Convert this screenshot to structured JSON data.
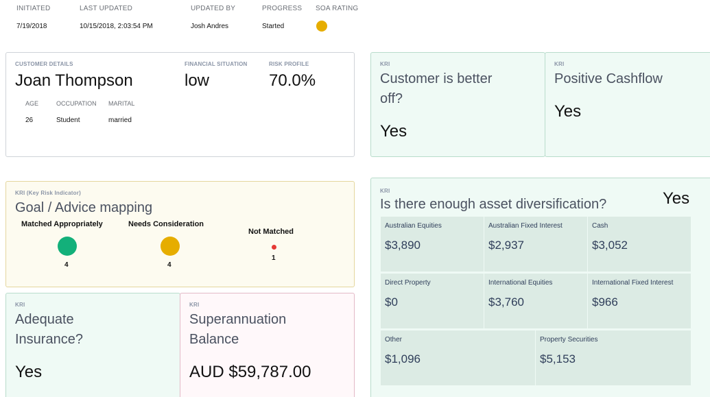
{
  "meta": {
    "labels": {
      "initiated": "INITIATED",
      "last_updated": "LAST UPDATED",
      "updated_by": "UPDATED BY",
      "progress": "PROGRESS",
      "soa_rating": "SOA RATING"
    },
    "values": {
      "initiated": "7/19/2018",
      "last_updated": "10/15/2018, 2:03:54 PM",
      "updated_by": "Josh Andres",
      "progress": "Started"
    },
    "soa_color": "#e6ad00"
  },
  "customer": {
    "section_label": "CUSTOMER DETAILS",
    "name": "Joan Thompson",
    "financial_label": "FINANCIAL SITUATION",
    "financial_value": "low",
    "risk_label": "RISK PROFILE",
    "risk_value": "70.0%",
    "age_label": "AGE",
    "age_value": "26",
    "occupation_label": "OCCUPATION",
    "occupation_value": "Student",
    "marital_label": "MARITAL",
    "marital_value": "married"
  },
  "kri_better_off": {
    "tag": "KRI",
    "title_line1": "Customer is better",
    "title_line2": "off?",
    "answer": "Yes"
  },
  "kri_cashflow": {
    "tag": "KRI",
    "title": "Positive Cashflow",
    "answer": "Yes"
  },
  "goal": {
    "tag": "KRI (Key Risk Indicator)",
    "title": "Goal / Advice mapping",
    "matched_label": "Matched Appropriately",
    "matched_count": "4",
    "matched_color": "#13b07a",
    "needs_label": "Needs Consideration",
    "needs_count": "4",
    "needs_color": "#e6ad00",
    "not_label": "Not Matched",
    "not_count": "1",
    "not_color": "#e53935"
  },
  "kri_insurance": {
    "tag": "KRI",
    "title_line1": "Adequate",
    "title_line2": "Insurance?",
    "answer": "Yes"
  },
  "kri_super": {
    "tag": "KRI",
    "title_line1": "Superannuation",
    "title_line2": "Balance",
    "answer": "AUD $59,787.00"
  },
  "kri_diversification": {
    "tag": "KRI",
    "title": "Is there enough asset diversification?",
    "answer": "Yes",
    "assets": [
      {
        "label": "Australian Equities",
        "value": "$3,890"
      },
      {
        "label": "Australian Fixed Interest",
        "value": "$2,937"
      },
      {
        "label": "Cash",
        "value": "$3,052"
      },
      {
        "label": "Direct Property",
        "value": "$0"
      },
      {
        "label": "International Equities",
        "value": "$3,760"
      },
      {
        "label": "International Fixed Interest",
        "value": "$966"
      },
      {
        "label": "Other",
        "value": "$1,096"
      },
      {
        "label": "Property Securities",
        "value": "$5,153"
      }
    ]
  }
}
